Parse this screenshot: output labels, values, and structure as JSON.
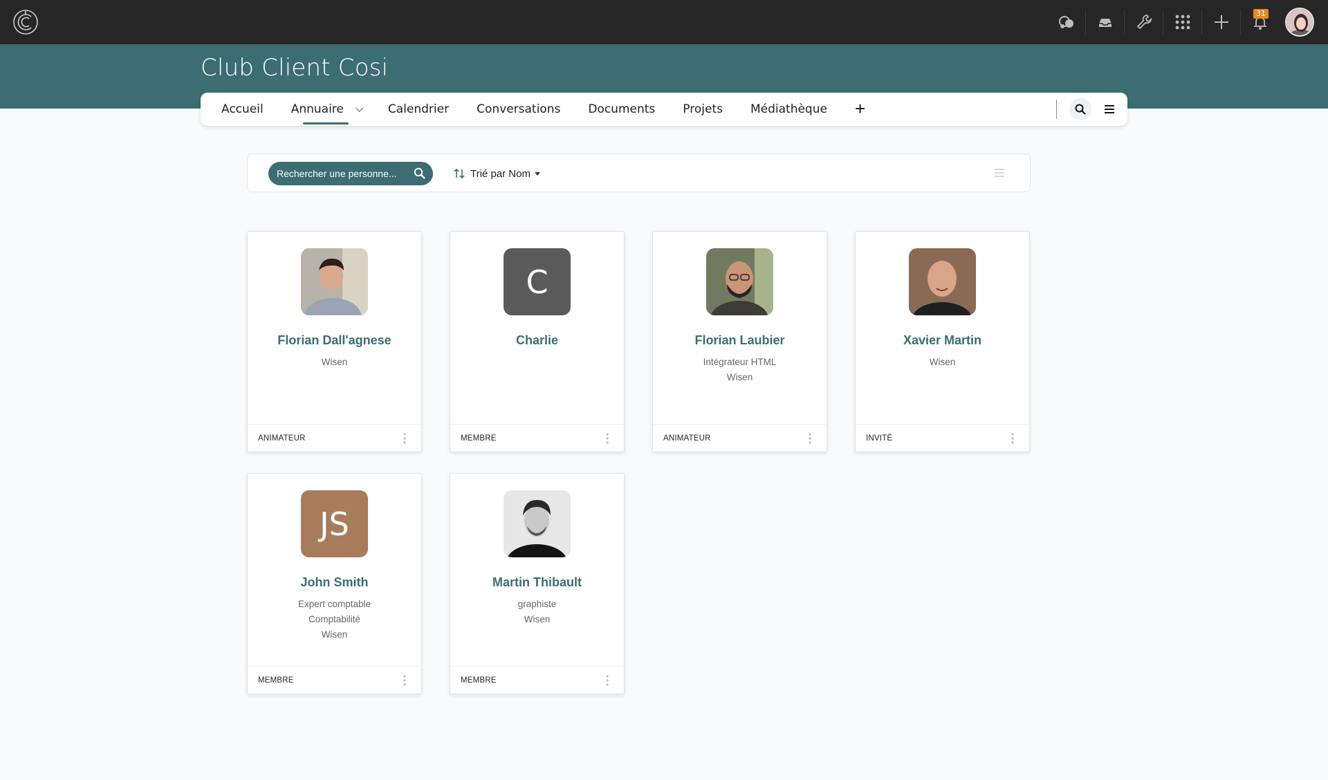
{
  "app": {
    "logo": "cosi-logo-icon",
    "page_title": "Club Client Cosi"
  },
  "topbar": {
    "icons": [
      "chat-bubbles-icon",
      "inbox-icon",
      "wrench-icon",
      "apps-grid-icon",
      "plus-icon",
      "bell-icon"
    ],
    "notification_count": "31"
  },
  "nav": {
    "items": [
      {
        "label": "Accueil"
      },
      {
        "label": "Annuaire",
        "active": true,
        "has_dropdown": true
      },
      {
        "label": "Calendrier"
      },
      {
        "label": "Conversations"
      },
      {
        "label": "Documents"
      },
      {
        "label": "Projets"
      },
      {
        "label": "Médiathèque"
      }
    ],
    "add_label": "+"
  },
  "filter": {
    "search_placeholder": "Rechercher une personne...",
    "sort_label": "Trié par Nom"
  },
  "colors": {
    "teal": "#3b6d72",
    "topbar": "#262626",
    "badge": "#e58a1f"
  },
  "members": [
    {
      "name": "Florian Dall'agnese",
      "lines": [
        "Wisen"
      ],
      "role": "ANIMATEUR",
      "avatar": "photo"
    },
    {
      "name": "Charlie",
      "lines": [],
      "role": "MEMBRE",
      "avatar": "initials",
      "initials": "C",
      "color": "#5a5a5a"
    },
    {
      "name": "Florian Laubier",
      "lines": [
        "Intégrateur HTML",
        "Wisen"
      ],
      "role": "ANIMATEUR",
      "avatar": "photo"
    },
    {
      "name": "Xavier Martin",
      "lines": [
        "Wisen"
      ],
      "role": "INVITÉ",
      "avatar": "photo"
    },
    {
      "name": "John Smith",
      "lines": [
        "Expert comptable",
        "Comptabilité",
        "Wisen"
      ],
      "role": "MEMBRE",
      "avatar": "initials",
      "initials": "JS",
      "color": "#a67c5b"
    },
    {
      "name": "Martin Thibault",
      "lines": [
        "graphiste",
        "Wisen"
      ],
      "role": "MEMBRE",
      "avatar": "photo"
    }
  ]
}
